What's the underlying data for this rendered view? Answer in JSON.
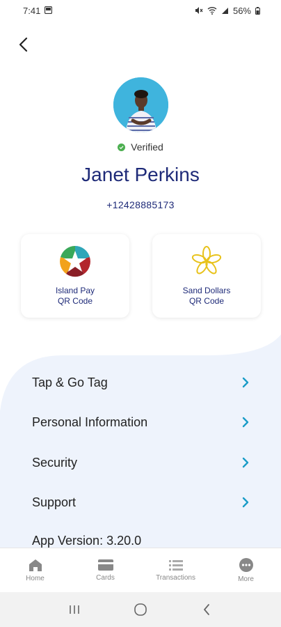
{
  "status_bar": {
    "time": "7:41",
    "battery": "56%"
  },
  "profile": {
    "verified_label": "Verified",
    "name": "Janet Perkins",
    "phone": "+12428885173"
  },
  "qr_cards": {
    "island_pay": {
      "line1": "Island Pay",
      "line2": "QR Code"
    },
    "sand_dollars": {
      "line1": "Sand Dollars",
      "line2": "QR Code"
    }
  },
  "menu": {
    "items": [
      {
        "label": "Tap & Go Tag"
      },
      {
        "label": "Personal Information"
      },
      {
        "label": "Security"
      },
      {
        "label": "Support"
      }
    ],
    "app_version": "App Version: 3.20.0"
  },
  "bottom_nav": {
    "items": [
      {
        "label": "Home",
        "icon": "home-icon"
      },
      {
        "label": "Cards",
        "icon": "card-icon"
      },
      {
        "label": "Transactions",
        "icon": "list-icon"
      },
      {
        "label": "More",
        "icon": "more-icon"
      }
    ]
  },
  "colors": {
    "brand_navy": "#1e2a78",
    "chevron": "#1a9cc7",
    "verified": "#4caf50",
    "panel": "#eef3fc"
  }
}
